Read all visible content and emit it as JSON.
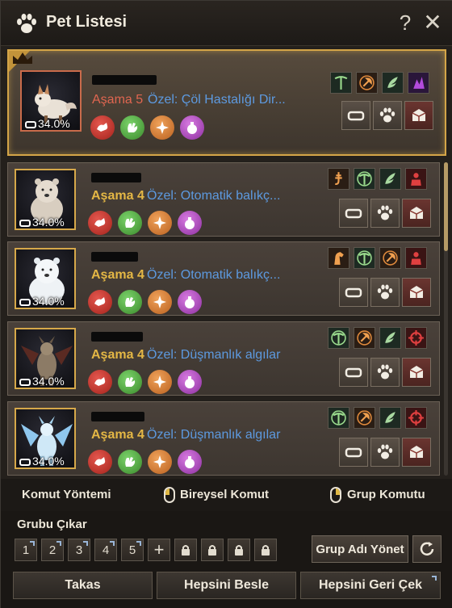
{
  "window": {
    "title": "Pet Listesi",
    "help_label": "?",
    "close_label": "✕"
  },
  "pets": [
    {
      "tier_label": "Aşama",
      "tier_value": "5",
      "special": "Özel: Çöl Hastalığı Dir...",
      "hunger": "34.0%",
      "selected": true,
      "skills": [
        "pickaxe-icon",
        "axe-icon",
        "wing-icon",
        "purple-crystal-icon"
      ]
    },
    {
      "tier_label": "Aşama",
      "tier_value": "4",
      "special": "Özel: Otomatik balıkç...",
      "hunger": "34.0%",
      "selected": false,
      "skills": [
        "bait-icon",
        "pickaxe-icon",
        "wing-icon",
        "red-guard-icon"
      ]
    },
    {
      "tier_label": "Aşama",
      "tier_value": "4",
      "special": "Özel: Otomatik balıkç...",
      "hunger": "34.0%",
      "selected": false,
      "skills": [
        "horse-icon",
        "pickaxe-icon",
        "axe-icon",
        "red-guard-icon"
      ]
    },
    {
      "tier_label": "Aşama",
      "tier_value": "4",
      "special": "Özel: Düşmanlık algılar",
      "hunger": "34.0%",
      "selected": false,
      "skills": [
        "pickaxe-icon",
        "axe-icon",
        "wing-icon",
        "crosshair-icon"
      ]
    },
    {
      "tier_label": "Aşama",
      "tier_value": "4",
      "special": "Özel: Düşmanlık algılar",
      "hunger": "34.0%",
      "selected": false,
      "skills": [
        "pickaxe-icon",
        "axe-icon",
        "wing-icon",
        "crosshair-icon"
      ]
    }
  ],
  "command": {
    "method_label": "Komut Yöntemi",
    "individual_label": "Bireysel Komut",
    "group_label": "Grup Komutu"
  },
  "group": {
    "title": "Grubu Çıkar",
    "slots": [
      "1",
      "2",
      "3",
      "4",
      "5"
    ],
    "add_label": "+",
    "manage_label": "Grup Adı Yönet"
  },
  "bottom": {
    "trade_label": "Takas",
    "feed_all_label": "Hepsini Besle",
    "recall_all_label": "Hepsini Geri Çek"
  },
  "colors": {
    "accent_gold": "#d4a548",
    "tier_red": "#e06650",
    "tier_gold": "#e4b745",
    "special_blue": "#5d9ae0"
  }
}
